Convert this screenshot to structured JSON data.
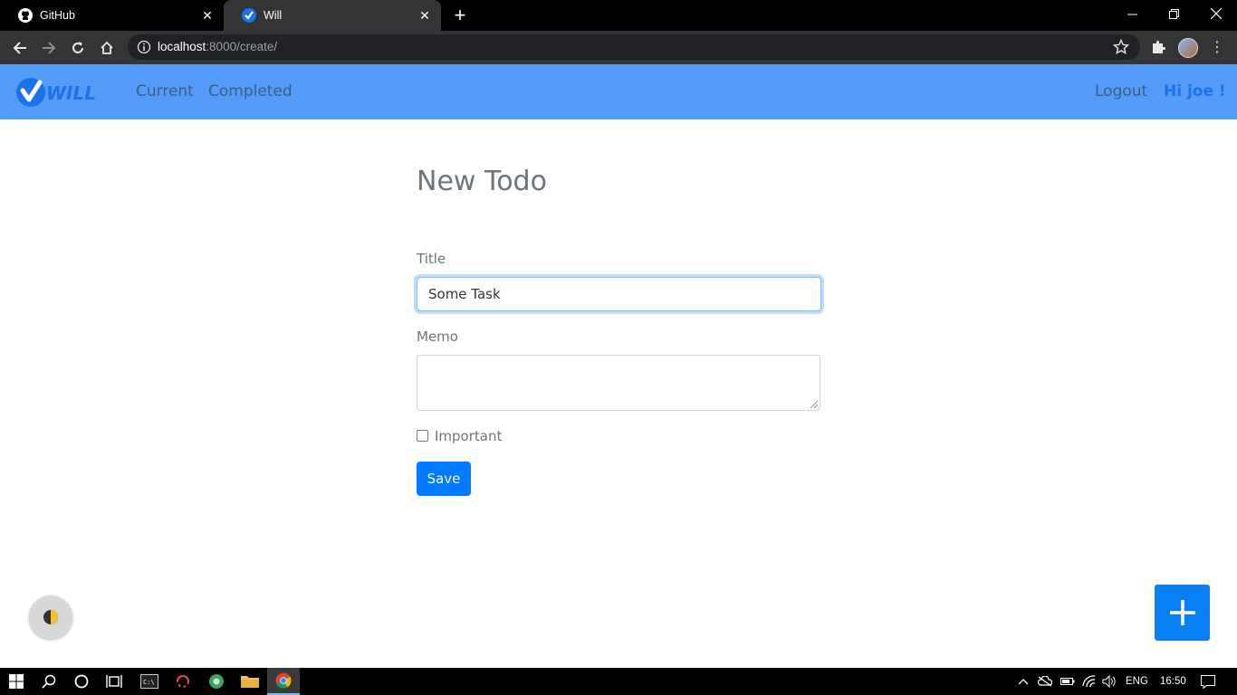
{
  "browser": {
    "tabs": [
      {
        "title": "GitHub",
        "icon": "github-icon"
      },
      {
        "title": "Will",
        "icon": "will-check-icon",
        "active": true
      }
    ],
    "url_host": "localhost",
    "url_path": ":8000/create/"
  },
  "app": {
    "brand_text": "WILL",
    "nav": {
      "current": "Current",
      "completed": "Completed",
      "logout": "Logout",
      "greeting": "Hi joe !"
    },
    "colors": {
      "navbar": "#559bfa",
      "primary": "#007bff"
    }
  },
  "form": {
    "heading": "New Todo",
    "title_label": "Title",
    "title_value": "Some Task",
    "memo_label": "Memo",
    "memo_value": "",
    "important_label": "Important",
    "important_checked": false,
    "save_label": "Save"
  },
  "taskbar": {
    "language": "ENG",
    "time": "16:50"
  }
}
